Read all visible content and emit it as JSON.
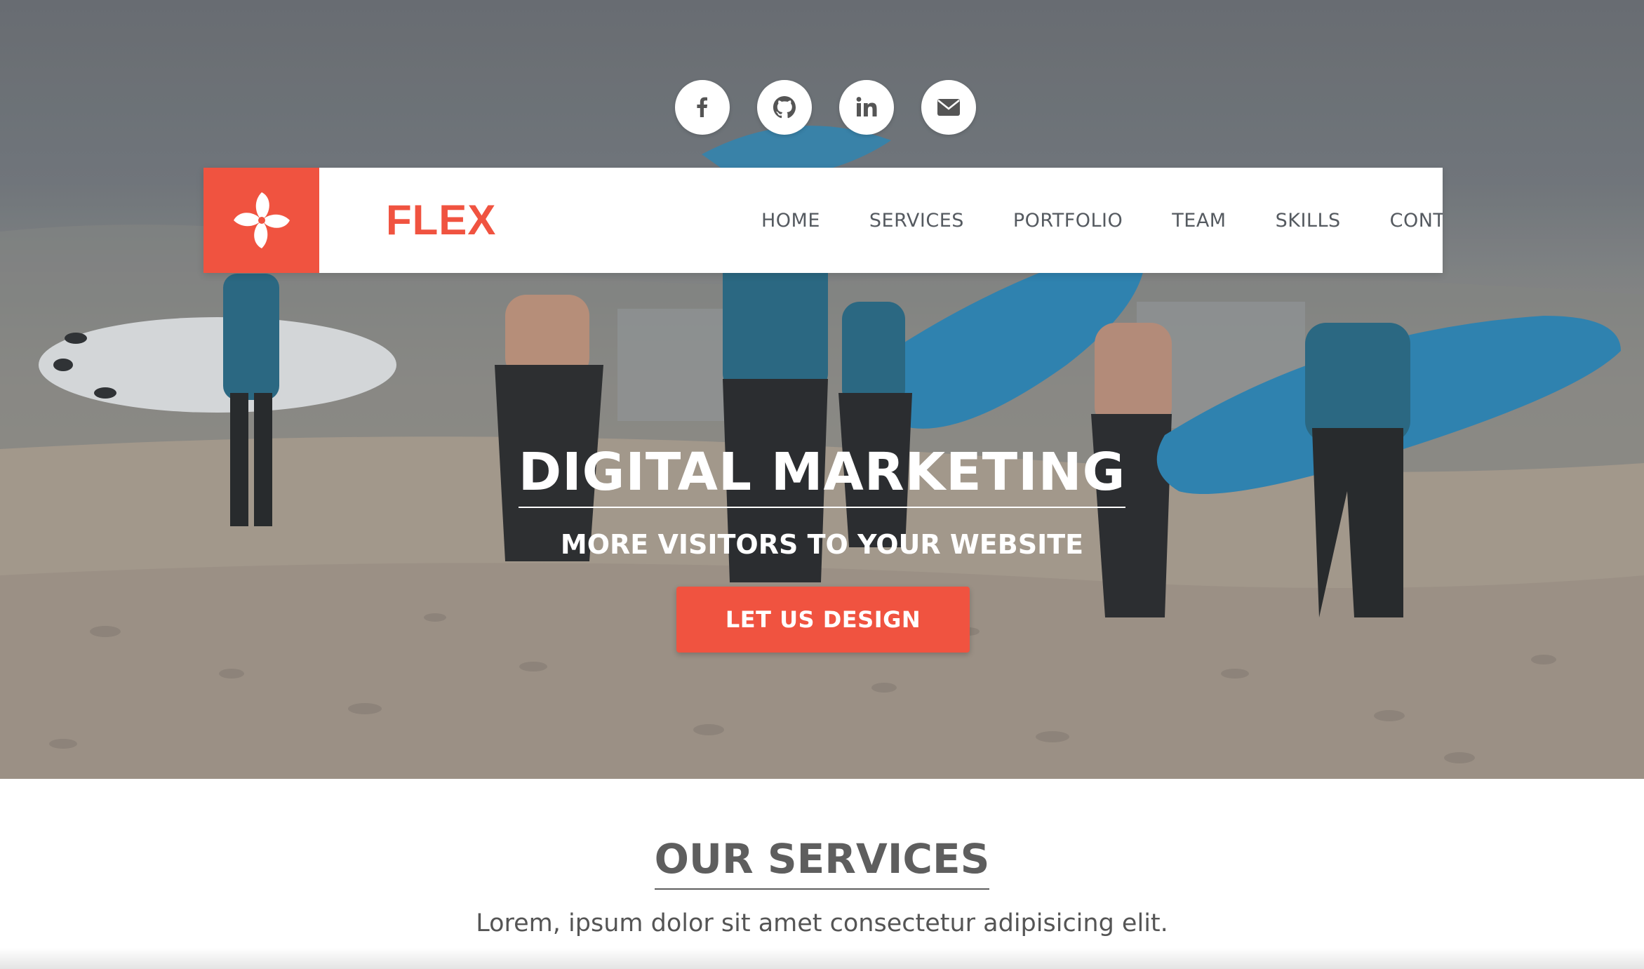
{
  "social": [
    {
      "icon": "facebook-icon",
      "label": "f"
    },
    {
      "icon": "github-icon"
    },
    {
      "icon": "linkedin-icon",
      "label": "in"
    },
    {
      "icon": "envelope-icon"
    }
  ],
  "navbar": {
    "brand": "FLEX",
    "logo_icon": "pinwheel-icon",
    "links": [
      "HOME",
      "SERVICES",
      "PORTFOLIO",
      "TEAM",
      "SKILLS",
      "CONTACT"
    ]
  },
  "hero": {
    "title": "DIGITAL MARKETING",
    "subtitle": "MORE VISITORS TO YOUR WEBSITE",
    "cta_label": "LET US DESIGN"
  },
  "services": {
    "title": "OUR SERVICES",
    "description": "Lorem, ipsum dolor sit amet consectetur adipisicing elit."
  },
  "colors": {
    "accent": "#f05340",
    "nav_text": "#555a60",
    "heading_gray": "#5e5e5e"
  }
}
